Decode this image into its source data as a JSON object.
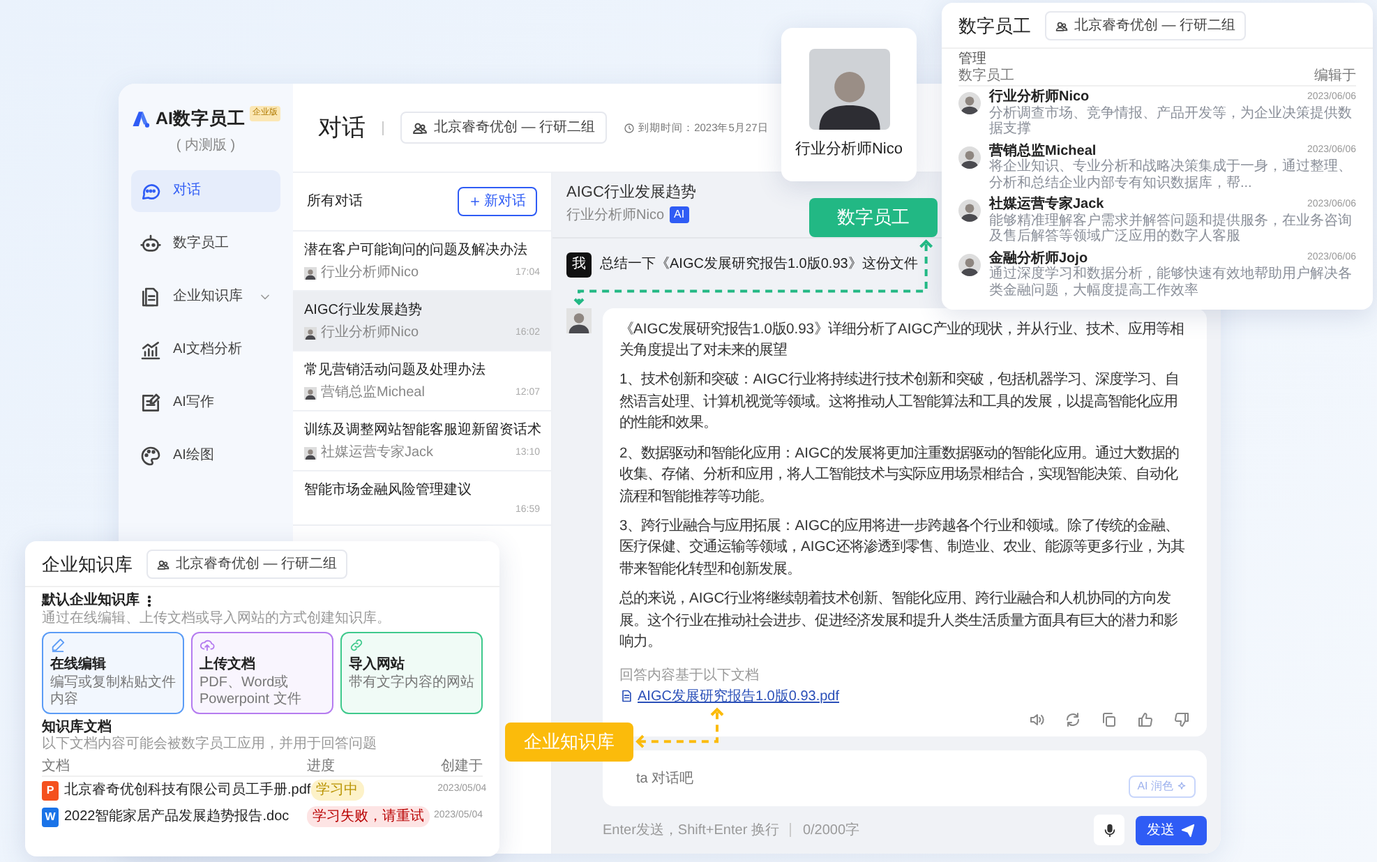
{
  "app": {
    "logo_name": "AI数字员工",
    "edition_badge": "企业版",
    "edition_note": "( 内测版 )"
  },
  "sidebar": {
    "items": [
      {
        "label": "对话",
        "kind": "chat",
        "selected": true,
        "expandable": false
      },
      {
        "label": "数字员工",
        "kind": "robot",
        "selected": false,
        "expandable": false
      },
      {
        "label": "企业知识库",
        "kind": "library",
        "selected": false,
        "expandable": true
      },
      {
        "label": "AI文档分析",
        "kind": "analysis",
        "selected": false,
        "expandable": false
      },
      {
        "label": "AI写作",
        "kind": "writing",
        "selected": false,
        "expandable": false
      },
      {
        "label": "AI绘图",
        "kind": "drawing",
        "selected": false,
        "expandable": false
      }
    ]
  },
  "header": {
    "title": "对话",
    "org": "北京睿奇优创 — 行研二组",
    "expiry": "到期时间：2023年5月27日"
  },
  "conversations": {
    "title": "所有对话",
    "new_button": "新对话",
    "items": [
      {
        "title": "潜在客户可能询问的问题及解决办法",
        "author": "行业分析师Nico",
        "time": "17:04",
        "selected": false
      },
      {
        "title": "AIGC行业发展趋势",
        "author": "行业分析师Nico",
        "time": "16:02",
        "selected": true
      },
      {
        "title": "常见营销活动问题及处理办法",
        "author": "营销总监Micheal",
        "time": "12:07",
        "selected": false
      },
      {
        "title": "训练及调整网站智能客服迎新留资话术",
        "author": "社媒运营专家Jack",
        "time": "13:10",
        "selected": false
      },
      {
        "title": "智能市场金融风险管理建议",
        "time": "16:59",
        "selected": false
      }
    ]
  },
  "chat": {
    "title": "AIGC行业发展趋势",
    "agent": "行业分析师Nico",
    "agent_badge": "AI",
    "user_avatar": "我",
    "user_message": "总结一下《AIGC发展研究报告1.0版0.93》这份文件",
    "answer": [
      "《AIGC发展研究报告1.0版0.93》详细分析了AIGC产业的现状，并从行业、技术、应用等相关角度提出了对未来的展望",
      "1、技术创新和突破：AIGC行业将持续进行技术创新和突破，包括机器学习、深度学习、自然语言处理、计算机视觉等领域。这将推动人工智能算法和工具的发展，以提高智能化应用的性能和效果。",
      "2、数据驱动和智能化应用：AIGC的发展将更加注重数据驱动的智能化应用。通过大数据的收集、存储、分析和应用，将人工智能技术与实际应用场景相结合，实现智能决策、自动化流程和智能推荐等功能。",
      "3、跨行业融合与应用拓展：AIGC的应用将进一步跨越各个行业和领域。除了传统的金融、医疗保健、交通运输等领域，AIGC还将渗透到零售、制造业、农业、能源等更多行业，为其带来智能化转型和创新发展。",
      "总的来说，AIGC行业将继续朝着技术创新、智能化应用、跨行业融合和人机协同的方向发展。这个行业在推动社会进步、促进经济发展和提升人类生活质量方面具有巨大的潜力和影响力。"
    ],
    "source_label": "回答内容基于以下文档",
    "source_file": "AIGC发展研究报告1.0版0.93.pdf",
    "input_placeholder": "ta 对话吧",
    "polish_button": "AI 润色",
    "hint": "Enter发送，Shift+Enter 换行",
    "counter": "0/2000字",
    "send_button": "发送"
  },
  "callouts": [
    {
      "label": "数字员工",
      "color": "#22b884"
    },
    {
      "label": "企业知识库",
      "color": "#fbbb0b"
    }
  ],
  "profile_card": {
    "name": "行业分析师Nico"
  },
  "employee_panel": {
    "title": "数字员工",
    "org": "北京睿奇优创 — 行研二组",
    "section": "管理",
    "columns": [
      "数字员工",
      "编辑于"
    ],
    "rows": [
      {
        "name": "行业分析师Nico",
        "desc": "分析调查市场、竞争情报、产品开发等，为企业决策提供数据支撑",
        "date": "2023/06/06"
      },
      {
        "name": "营销总监Micheal",
        "desc": "将企业知识、专业分析和战略决策集成于一身，通过整理、分析和总结企业内部专有知识数据库，帮...",
        "date": "2023/06/06"
      },
      {
        "name": "社媒运营专家Jack",
        "desc": "能够精准理解客户需求并解答问题和提供服务，在业务咨询及售后解答等领域广泛应用的数字人客服",
        "date": "2023/06/06"
      },
      {
        "name": "金融分析师Jojo",
        "desc": "通过深度学习和数据分析，能够快速有效地帮助用户解决各类金融问题，大幅度提高工作效率",
        "date": "2023/06/06"
      }
    ]
  },
  "knowledge_panel": {
    "title": "企业知识库",
    "org": "北京睿奇优创 — 行研二组",
    "default_title": "默认企业知识库",
    "default_desc": "通过在线编辑、上传文档或导入网站的方式创建知识库。",
    "options": [
      {
        "kind": "edit",
        "title": "在线编辑",
        "desc": "编写或复制粘贴文件内容",
        "color": "#5b9cf6"
      },
      {
        "kind": "upload",
        "title": "上传文档",
        "desc": "PDF、Word或Powerpoint 文件",
        "color": "#b57cf0"
      },
      {
        "kind": "link",
        "title": "导入网站",
        "desc": "带有文字内容的网站",
        "color": "#3fc98c"
      }
    ],
    "docs_title": "知识库文档",
    "docs_desc": "以下文档内容可能会被数字员工应用，并用于回答问题",
    "columns": [
      "文档",
      "进度",
      "创建于"
    ],
    "docs": [
      {
        "type_letter": "P",
        "color": "#f4511e",
        "name": "北京睿奇优创科技有限公司员工手册.pdf",
        "status": {
          "label": "学习中",
          "color": "#fdf2c8"
        },
        "date": "2023/05/04"
      },
      {
        "type_letter": "W",
        "color": "#1a73e8",
        "name": "2022智能家居产品发展趋势报告.doc",
        "status": {
          "label": "学习失败，请重试",
          "color": "#fde4e4"
        },
        "date": "2023/05/04"
      }
    ]
  }
}
